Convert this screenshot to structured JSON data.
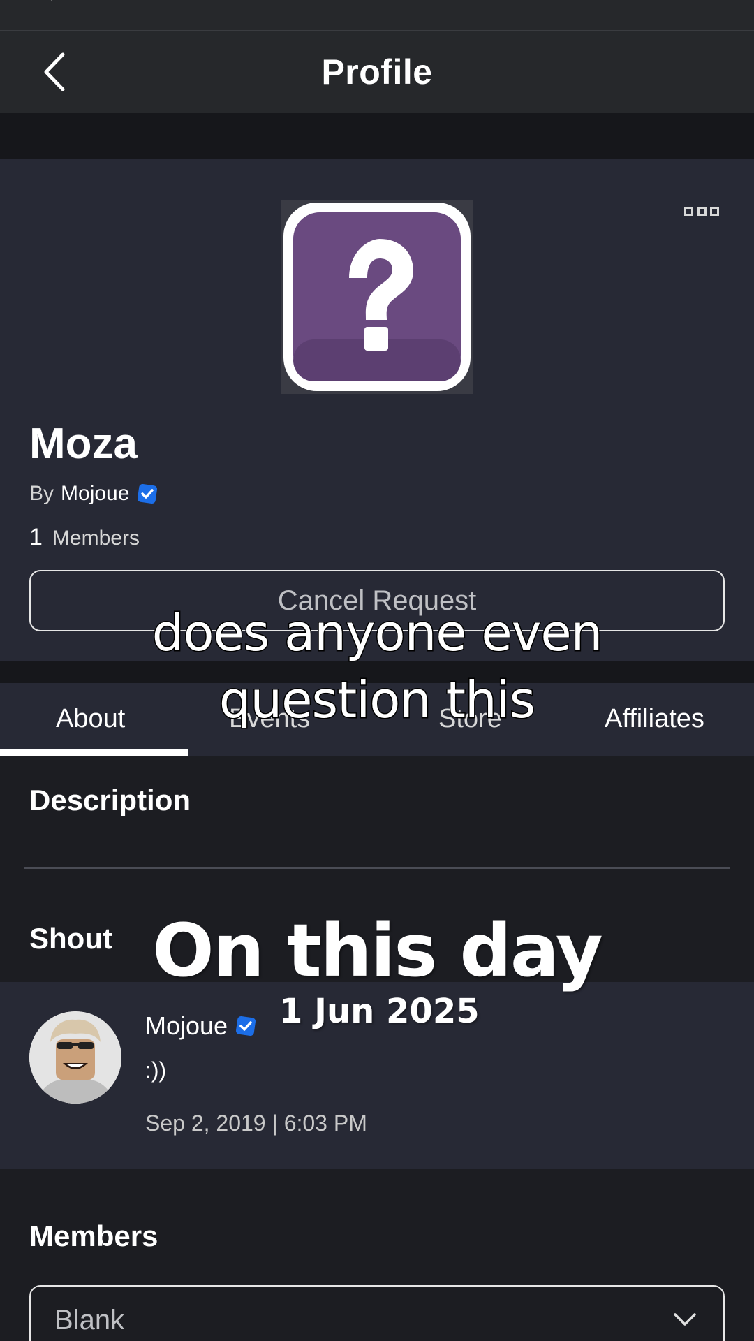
{
  "nav": {
    "title": "Profile"
  },
  "group": {
    "name": "Moza",
    "by_prefix": "By",
    "owner": "Mojoue",
    "member_count": "1",
    "members_label": "Members",
    "action_button": "Cancel Request"
  },
  "tabs": [
    {
      "label": "About",
      "active": true
    },
    {
      "label": "Events",
      "active": false
    },
    {
      "label": "Store",
      "active": false
    },
    {
      "label": "Affiliates",
      "active": false
    }
  ],
  "about": {
    "description_title": "Description",
    "shout_title": "Shout",
    "shout": {
      "poster": "Mojoue",
      "message": ":))",
      "timestamp": "Sep 2, 2019 | 6:03 PM"
    },
    "members_title": "Members",
    "members_select_value": "Blank"
  },
  "overlay": {
    "caption_line1": "does anyone even",
    "caption_line2": "question this",
    "on_this_day": "On this day",
    "date": "1 Jun 2025"
  },
  "colors": {
    "background": "#1c1d22",
    "card": "#272935",
    "navbar": "#26282b",
    "verified_blue": "#1c6ee8",
    "icon_purple": "#6a4a80"
  },
  "icons": [
    "back-chevron-icon",
    "more-options-icon",
    "question-mark-icon",
    "verified-badge-icon",
    "chevron-down-icon"
  ]
}
